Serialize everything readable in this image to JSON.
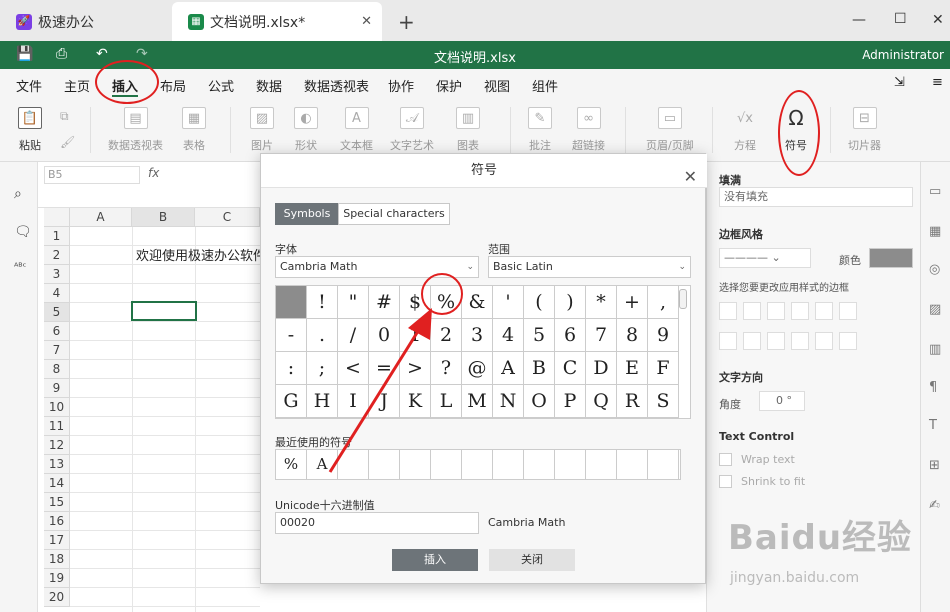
{
  "tabs": [
    {
      "label": "极速办公",
      "icon": "rocket-icon"
    },
    {
      "label": "文档说明.xlsx*",
      "icon": "spreadsheet-icon"
    }
  ],
  "window": {
    "title": "文档说明.xlsx",
    "user": "Administrator",
    "brand_color": "#217346"
  },
  "menu": [
    "文件",
    "主页",
    "插入",
    "布局",
    "公式",
    "数据",
    "数据透视表",
    "协作",
    "保护",
    "视图",
    "组件"
  ],
  "ribbon": {
    "paste": "粘贴",
    "pivot": "数据透视表",
    "table": "表格",
    "image": "图片",
    "shape": "形状",
    "textbox": "文本框",
    "textart": "文字艺术",
    "chart": "图表",
    "comment": "批注",
    "hyperlink": "超链接",
    "header_footer": "页眉/页脚",
    "formula": "方程",
    "symbol": "符号",
    "slicer": "切片器"
  },
  "formula_bar": {
    "name_box": "B5",
    "fx": "fx"
  },
  "sheet": {
    "columns": [
      "A",
      "B",
      "C"
    ],
    "rows": [
      "1",
      "2",
      "3",
      "4",
      "5",
      "6",
      "7",
      "8",
      "9",
      "10",
      "11",
      "12",
      "13",
      "14",
      "15",
      "16",
      "17",
      "18",
      "19",
      "20"
    ],
    "b2_text": "欢迎使用极速办公软件",
    "selected_cell": "B5"
  },
  "dialog": {
    "title": "符号",
    "tabs": [
      "Symbols",
      "Special characters"
    ],
    "font_label": "字体",
    "font_value": "Cambria Math",
    "range_label": "范围",
    "range_value": "Basic Latin",
    "symbols": [
      " ",
      "!",
      "\"",
      "#",
      "$",
      "%",
      "&",
      "'",
      "(",
      ")",
      "*",
      "+",
      ",",
      "-",
      ".",
      "/",
      "0",
      "1",
      "2",
      "3",
      "4",
      "5",
      "6",
      "7",
      "8",
      "9",
      ":",
      ";",
      "<",
      "=",
      ">",
      "?",
      "@",
      "A",
      "B",
      "C",
      "D",
      "E",
      "F",
      "G",
      "H",
      "I",
      "J",
      "K",
      "L",
      "M",
      "N",
      "O",
      "P",
      "Q",
      "R",
      "S"
    ],
    "recent_label": "最近使用的符号",
    "recent": [
      "%",
      "A",
      "",
      "",
      "",
      "",
      "",
      "",
      "",
      "",
      "",
      "",
      ""
    ],
    "unicode_label": "Unicode十六进制值",
    "unicode_value": "00020",
    "unicode_font": "Cambria Math",
    "insert_btn": "插入",
    "close_btn": "关闭"
  },
  "right_panel": {
    "fill_title": "填满",
    "fill_value": "没有填充",
    "border_title": "边框风格",
    "color_label": "颜色",
    "border_hint": "选择您要更改应用样式的边框",
    "text_direction": "文字方向",
    "angle_label": "角度",
    "angle_value": "0 °",
    "text_control": "Text Control",
    "wrap_text": "Wrap text",
    "shrink": "Shrink to fit"
  },
  "watermark": {
    "text": "Baidu经验",
    "sub": "jingyan.baidu.com"
  },
  "annotation_color": "#e02020"
}
